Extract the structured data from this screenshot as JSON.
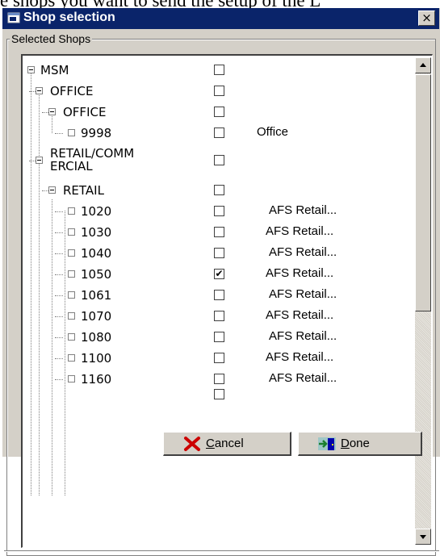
{
  "background_text": "e shops you want to send the setup of the L",
  "window": {
    "title": "Shop selection",
    "close_glyph": "×"
  },
  "group_label": "Selected Shops",
  "tree": [
    {
      "label": "MSM",
      "level": 0,
      "type": "branch",
      "checked": false,
      "desc": ""
    },
    {
      "label": "OFFICE",
      "level": 1,
      "type": "branch",
      "checked": false,
      "desc": ""
    },
    {
      "label": "OFFICE",
      "level": 2,
      "type": "branch",
      "checked": false,
      "desc": ""
    },
    {
      "label": "9998",
      "level": 3,
      "type": "leaf",
      "checked": false,
      "desc": "Office"
    },
    {
      "label": "RETAIL/COMM ERCIAL",
      "level": 1,
      "type": "branch",
      "checked": false,
      "desc": ""
    },
    {
      "label": "RETAIL",
      "level": 2,
      "type": "branch",
      "checked": false,
      "desc": ""
    },
    {
      "label": "1020",
      "level": 3,
      "type": "leaf",
      "checked": false,
      "desc": "AFS Retail..."
    },
    {
      "label": "1030",
      "level": 3,
      "type": "leaf",
      "checked": false,
      "desc": "AFS Retail..."
    },
    {
      "label": "1040",
      "level": 3,
      "type": "leaf",
      "checked": false,
      "desc": "AFS Retail..."
    },
    {
      "label": "1050",
      "level": 3,
      "type": "leaf",
      "checked": true,
      "desc": "AFS Retail..."
    },
    {
      "label": "1061",
      "level": 3,
      "type": "leaf",
      "checked": false,
      "desc": "AFS Retail..."
    },
    {
      "label": "1070",
      "level": 3,
      "type": "leaf",
      "checked": false,
      "desc": "AFS Retail..."
    },
    {
      "label": "1080",
      "level": 3,
      "type": "leaf",
      "checked": false,
      "desc": "AFS Retail..."
    },
    {
      "label": "1100",
      "level": 3,
      "type": "leaf",
      "checked": false,
      "desc": "AFS Retail..."
    },
    {
      "label": "1160",
      "level": 3,
      "type": "leaf",
      "checked": false,
      "desc": "AFS Retail..."
    }
  ],
  "check_glyph": "✔",
  "buttons": {
    "cancel": {
      "accel": "C",
      "rest": "ancel"
    },
    "done": {
      "accel": "D",
      "rest": "one"
    }
  },
  "colors": {
    "titlebar": "#0a246a",
    "face": "#d4d0c8",
    "cancel_icon": "#cc0000",
    "done_icon": "#0000aa"
  }
}
